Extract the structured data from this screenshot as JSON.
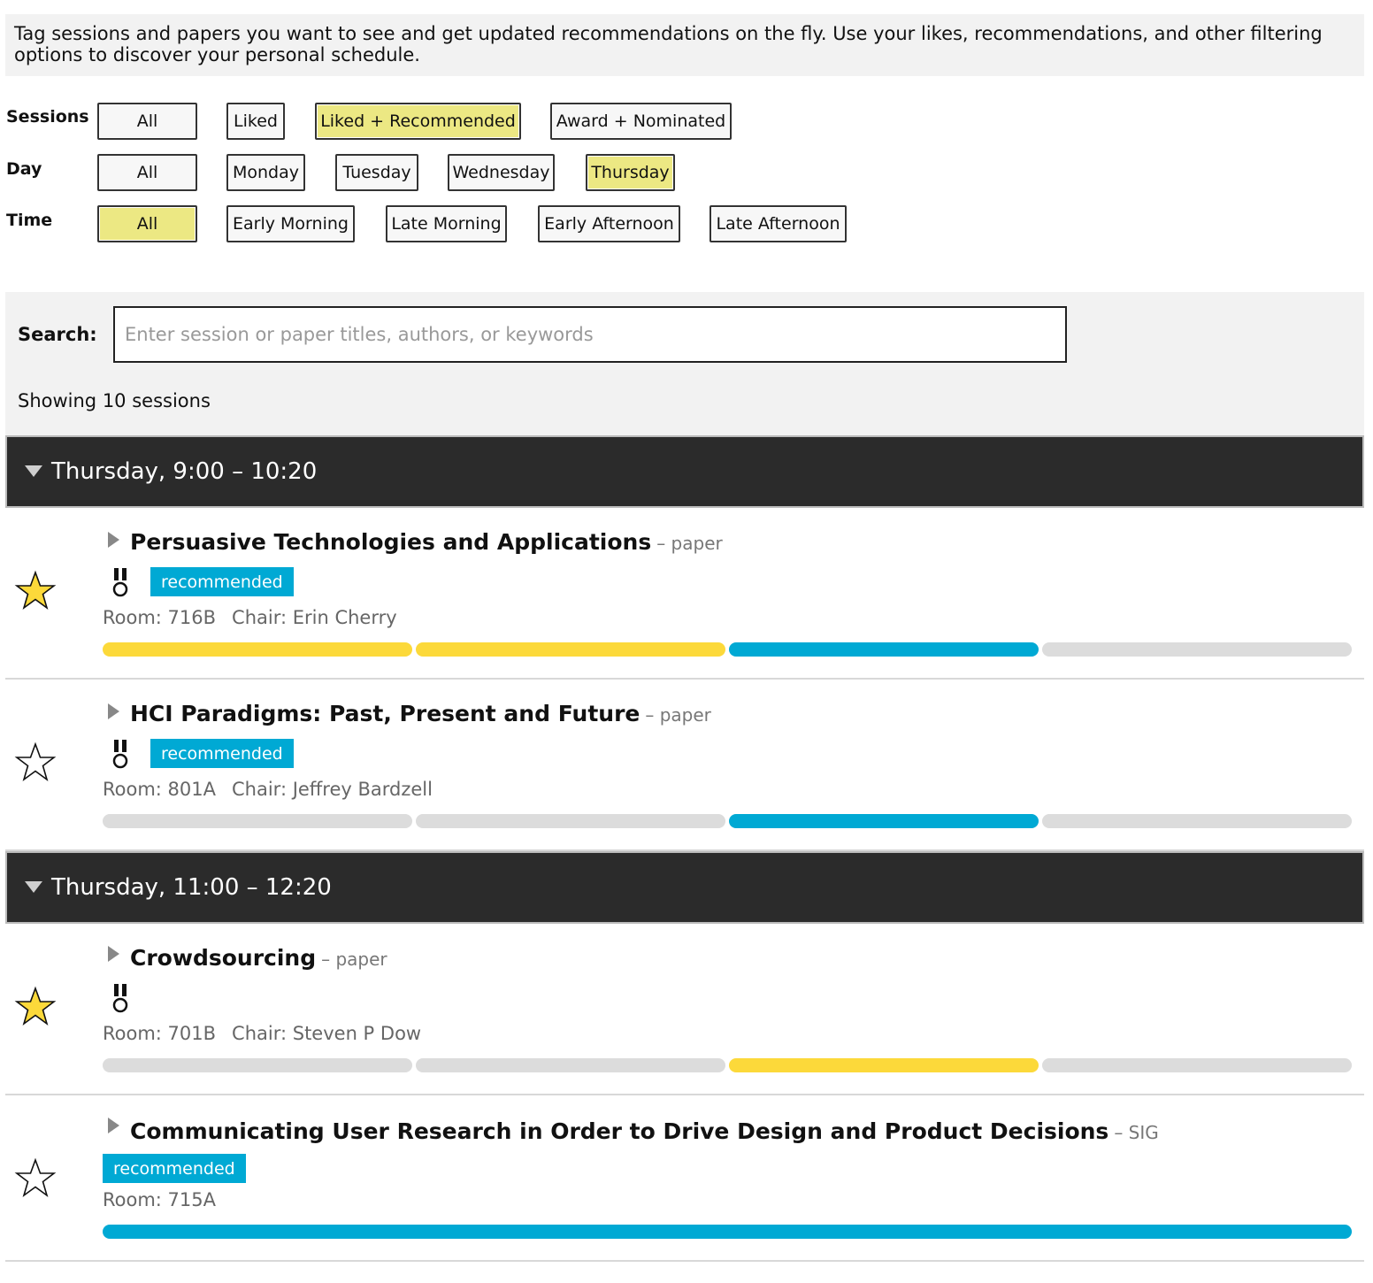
{
  "intro": "Tag sessions and papers you want to see and get updated recommendations on the fly. Use your likes, recommendations, and other filtering options to discover your personal schedule.",
  "filters": {
    "sessions": {
      "label": "Sessions",
      "options": [
        "All",
        "Liked",
        "Liked + Recommended",
        "Award + Nominated"
      ],
      "selected": "Liked + Recommended"
    },
    "day": {
      "label": "Day",
      "options": [
        "All",
        "Monday",
        "Tuesday",
        "Wednesday",
        "Thursday"
      ],
      "selected": "Thursday"
    },
    "time": {
      "label": "Time",
      "options": [
        "All",
        "Early Morning",
        "Late Morning",
        "Early Afternoon",
        "Late Afternoon"
      ],
      "selected": "All"
    }
  },
  "search": {
    "label": "Search:",
    "placeholder": "Enter session or paper titles, authors, or keywords",
    "showing": "Showing 10 sessions"
  },
  "colors": {
    "active_filter": "#ece883",
    "recommended": "#00a9d4",
    "liked": "#fcd93a",
    "neutral": "#dcdcdc",
    "header_bg": "#2b2b2b"
  },
  "time_slots": [
    {
      "header": "Thursday, 9:00 – 10:20",
      "sessions": [
        {
          "title": "Persuasive Technologies and Applications",
          "type": "– paper",
          "starred": true,
          "award_icon": "medal-icon",
          "badge": "recommended",
          "room": "Room: 716B",
          "chair": "Chair: Erin Cherry",
          "bar": [
            "yellow",
            "yellow",
            "blue",
            "grey"
          ]
        },
        {
          "title": "HCI Paradigms: Past, Present and Future",
          "type": "– paper",
          "starred": false,
          "award_icon": "medal-icon",
          "badge": "recommended",
          "room": "Room: 801A",
          "chair": "Chair: Jeffrey Bardzell",
          "bar": [
            "grey",
            "grey",
            "blue",
            "grey"
          ]
        }
      ]
    },
    {
      "header": "Thursday, 11:00 – 12:20",
      "sessions": [
        {
          "title": "Crowdsourcing",
          "type": "– paper",
          "starred": true,
          "award_icon": "medal-icon",
          "badge": "",
          "room": "Room: 701B",
          "chair": "Chair: Steven P Dow",
          "bar": [
            "grey",
            "grey",
            "yellow",
            "grey"
          ]
        },
        {
          "title": "Communicating User Research in Order to Drive Design and Product Decisions",
          "type": "– SIG",
          "starred": false,
          "award_icon": "",
          "badge": "recommended",
          "room": "Room: 715A",
          "chair": "",
          "bar": [
            "blue"
          ]
        }
      ]
    }
  ]
}
